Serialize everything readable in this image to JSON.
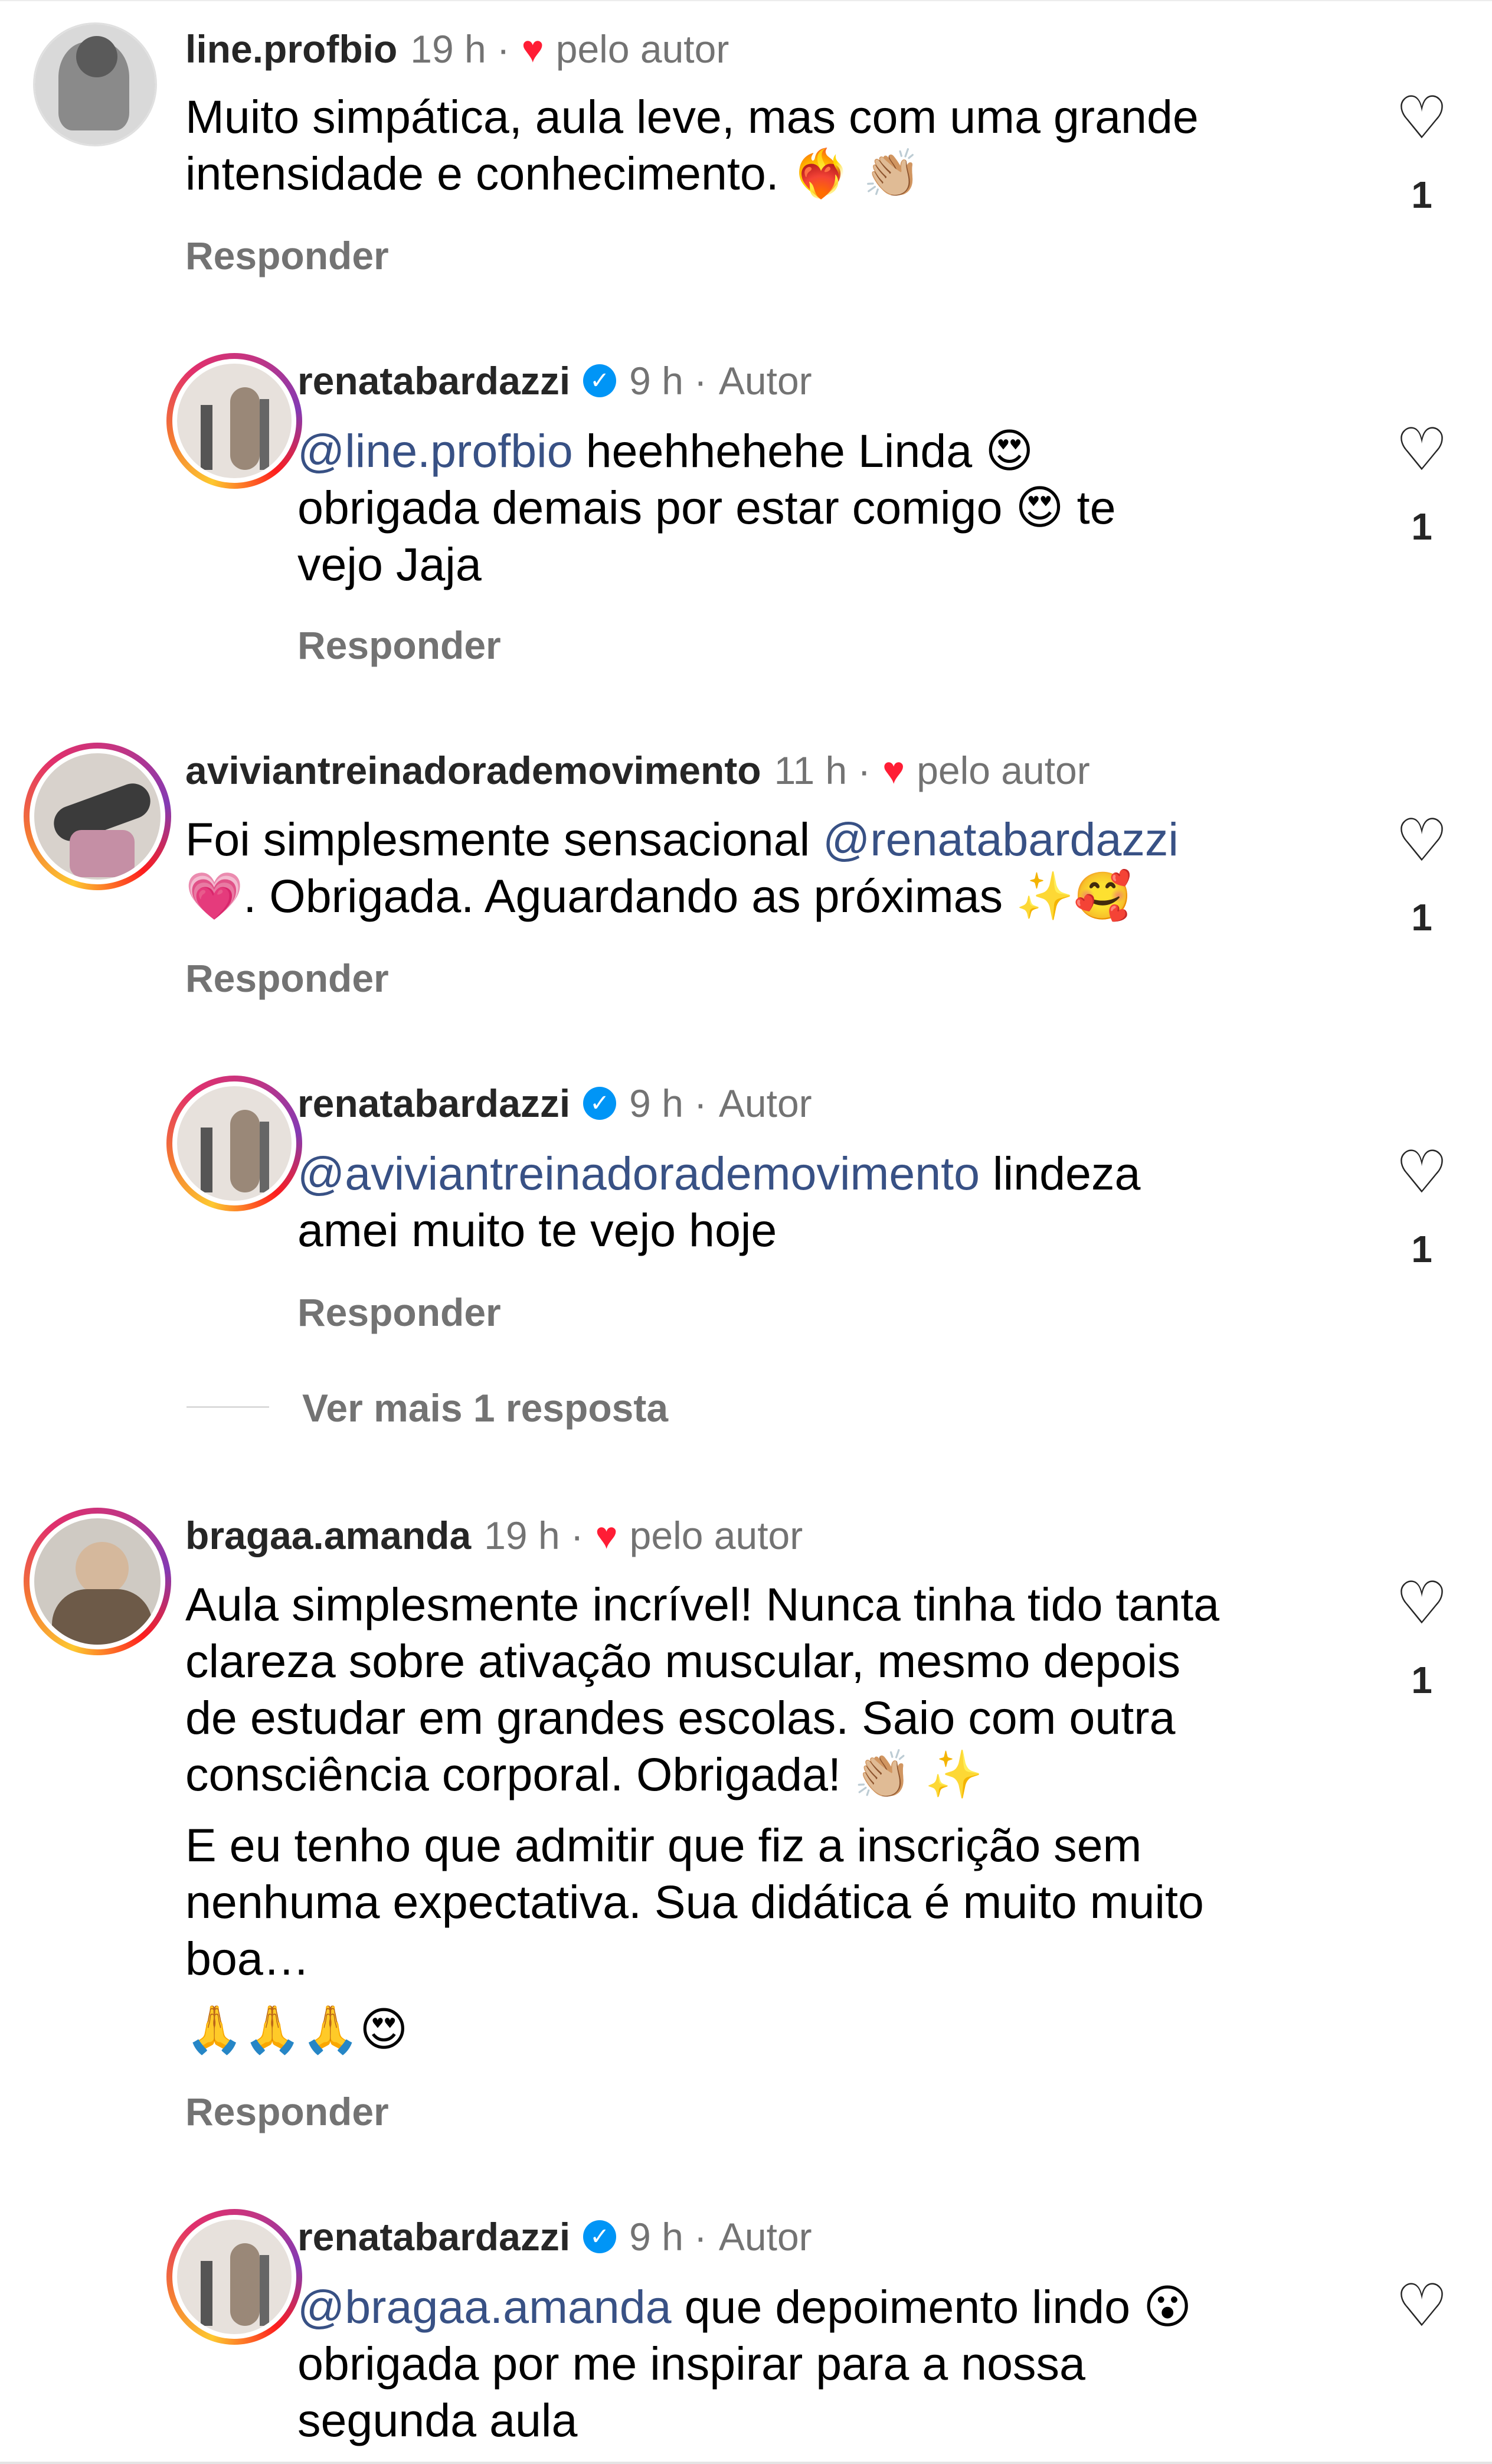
{
  "ui": {
    "verified_icon": "check-badge-icon",
    "like_icon": "heart-outline-icon",
    "author_like_icon": "heart-filled-icon",
    "colors": {
      "username": "#262626",
      "meta": "#737373",
      "mention": "#00376b",
      "author_heart": "#ff1d35",
      "verified": "#0095f6"
    }
  },
  "comments": [
    {
      "username": "line.profbio",
      "time": "19 h",
      "dot": "·",
      "author_like": "pelo autor",
      "text_lines": [
        "Muito simpática, aula leve, mas com uma grande",
        "intensidade e conhecimento. ❤️‍🔥 👏🏼"
      ],
      "reply_label": "Responder",
      "likes": "1"
    },
    {
      "username": "renatabardazzi",
      "time": "9 h",
      "dot": "·",
      "badge": "Autor",
      "mention": "@line.profbio",
      "text_lines": [
        " heehhehehe Linda 😍",
        "obrigada demais por estar comigo 😍 te",
        "vejo Jaja"
      ],
      "reply_label": "Responder",
      "likes": "1"
    },
    {
      "username": "aviviantreinadorademovimento",
      "time": "11 h",
      "dot": "·",
      "author_like": "pelo autor",
      "text_a": "Foi simplesmente sensacional ",
      "mention": "@renatabardazzi",
      "text_b": "💗. Obrigada. Aguardando as próximas ✨🥰",
      "reply_label": "Responder",
      "likes": "1"
    },
    {
      "username": "renatabardazzi",
      "time": "9 h",
      "dot": "·",
      "badge": "Autor",
      "mention": "@aviviantreinadorademovimento",
      "text_a": " lindeza",
      "text_b": "amei muito te vejo hoje",
      "reply_label": "Responder",
      "likes": "1"
    },
    {
      "username": "bragaa.amanda",
      "time": "19 h",
      "dot": "·",
      "author_like": "pelo autor",
      "para1": [
        "Aula simplesmente incrível! Nunca tinha tido tanta",
        "clareza sobre ativação muscular, mesmo depois",
        "de estudar em grandes escolas. Saio com outra",
        "consciência corporal. Obrigada! 👏🏼 ✨"
      ],
      "para2": [
        "E eu tenho que admitir que fiz a inscrição sem",
        "nenhuma expectativa. Sua didática é muito muito",
        "boa…"
      ],
      "para3": "🙏🙏🙏😍",
      "reply_label": "Responder",
      "likes": "1"
    },
    {
      "username": "renatabardazzi",
      "time": "9 h",
      "dot": "·",
      "badge": "Autor",
      "mention": "@bragaa.amanda",
      "text_a": " que depoimento lindo 😮",
      "text_b": "obrigada por me inspirar para a nossa",
      "text_c": "segunda aula"
    }
  ],
  "view_more": "Ver mais 1 resposta"
}
